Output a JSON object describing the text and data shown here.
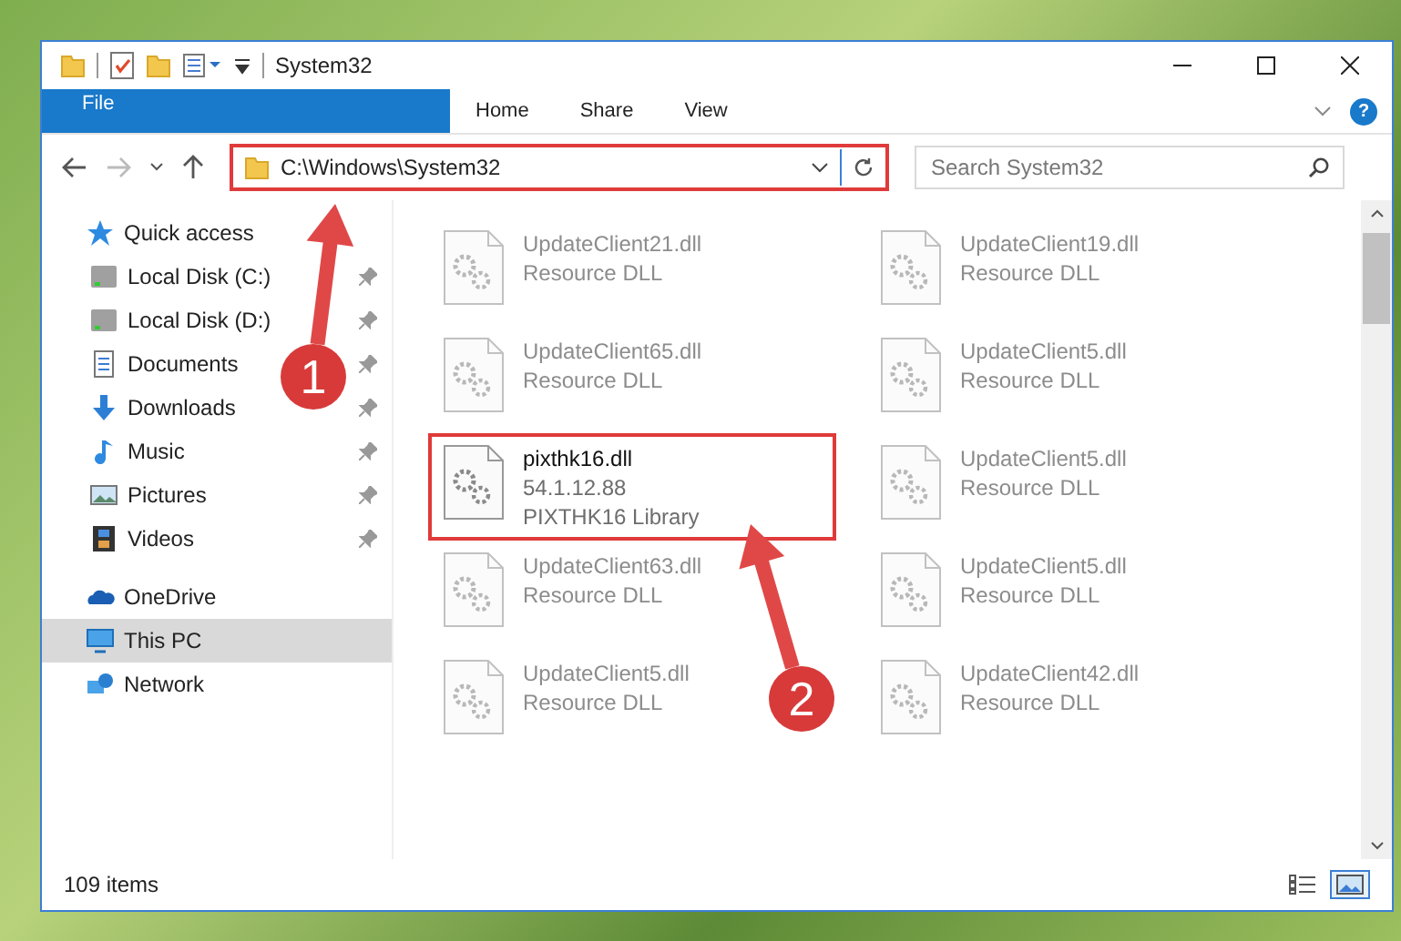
{
  "window": {
    "title": "System32"
  },
  "ribbon": {
    "tabs": [
      {
        "label": "File",
        "selected": true
      },
      {
        "label": "Home",
        "selected": false
      },
      {
        "label": "Share",
        "selected": false
      },
      {
        "label": "View",
        "selected": false
      }
    ],
    "help": "?"
  },
  "address": {
    "path": "C:\\Windows\\System32",
    "annotated": true
  },
  "search": {
    "placeholder": "Search System32"
  },
  "sidebar": {
    "items": [
      {
        "label": "Quick access",
        "selected": false,
        "children": [
          {
            "label": "Local Disk (C:)",
            "pinned": true,
            "selected": false
          },
          {
            "label": "Local Disk (D:)",
            "pinned": true,
            "selected": false
          },
          {
            "label": "Documents",
            "pinned": true,
            "selected": false
          },
          {
            "label": "Downloads",
            "pinned": true,
            "selected": false
          },
          {
            "label": "Music",
            "pinned": true,
            "selected": false
          },
          {
            "label": "Pictures",
            "pinned": true,
            "selected": false
          },
          {
            "label": "Videos",
            "pinned": true,
            "selected": false
          }
        ]
      },
      {
        "label": "OneDrive",
        "selected": false
      },
      {
        "label": "This PC",
        "selected": true
      },
      {
        "label": "Network",
        "selected": false
      }
    ]
  },
  "files": [
    {
      "name": "UpdateClient21.dll",
      "details": [
        "Resource DLL"
      ],
      "blurred": true,
      "annotated": false
    },
    {
      "name": "UpdateClient19.dll",
      "details": [
        "Resource DLL"
      ],
      "blurred": true,
      "annotated": false
    },
    {
      "name": "UpdateClient65.dll",
      "details": [
        "Resource DLL"
      ],
      "blurred": true,
      "annotated": false
    },
    {
      "name": "UpdateClient5.dll",
      "details": [
        "Resource DLL"
      ],
      "blurred": true,
      "annotated": false
    },
    {
      "name": "pixthk16.dll",
      "details": [
        "54.1.12.88",
        "PIXTHK16 Library"
      ],
      "blurred": false,
      "annotated": true
    },
    {
      "name": "UpdateClient5.dll",
      "details": [
        "Resource DLL"
      ],
      "blurred": true,
      "annotated": false
    },
    {
      "name": "UpdateClient63.dll",
      "details": [
        "Resource DLL"
      ],
      "blurred": true,
      "annotated": false
    },
    {
      "name": "UpdateClient5.dll",
      "details": [
        "Resource DLL"
      ],
      "blurred": true,
      "annotated": false
    },
    {
      "name": "UpdateClient5.dll",
      "details": [
        "Resource DLL"
      ],
      "blurred": true,
      "annotated": false
    },
    {
      "name": "UpdateClient42.dll",
      "details": [
        "Resource DLL"
      ],
      "blurred": true,
      "annotated": false
    }
  ],
  "status_bar": {
    "count": "109 items",
    "views": [
      {
        "kind": "details",
        "selected": false
      },
      {
        "kind": "large",
        "selected": true
      }
    ]
  },
  "annotations": [
    {
      "label": "1"
    },
    {
      "label": "2"
    }
  ]
}
